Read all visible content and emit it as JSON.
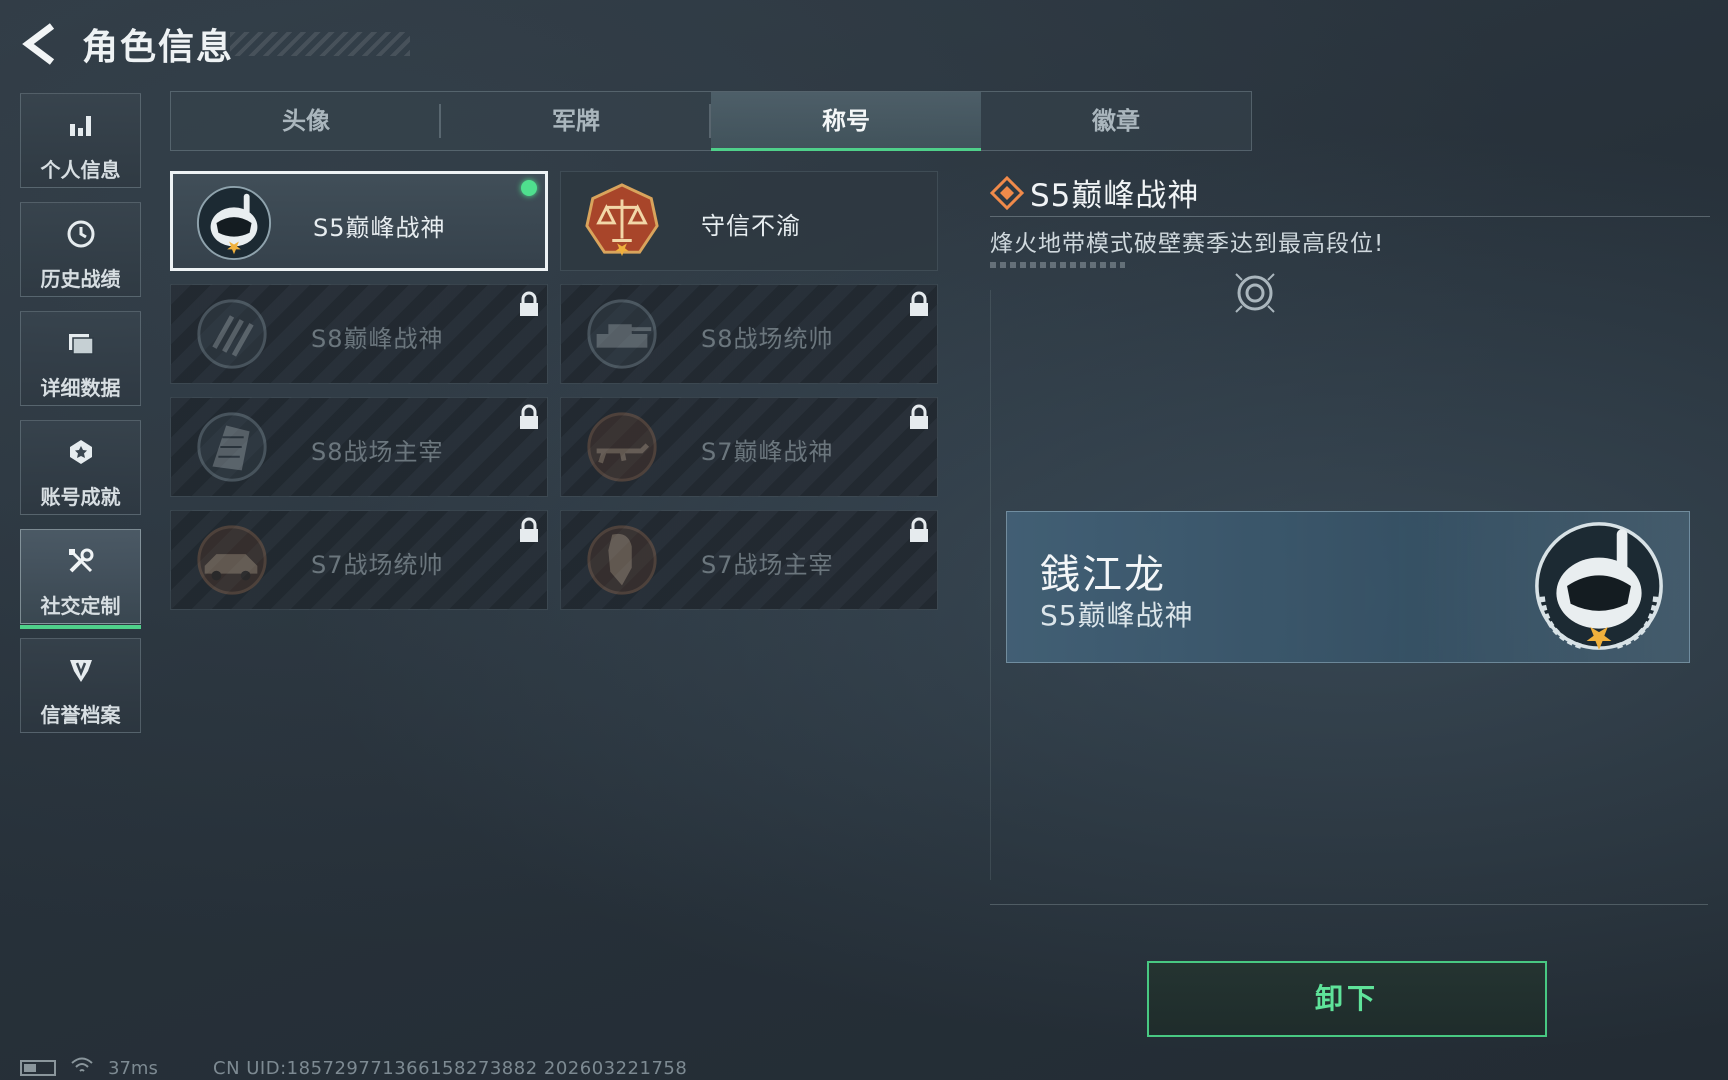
{
  "header": {
    "title": "角色信息"
  },
  "sidebar": {
    "items": [
      {
        "label": "个人信息",
        "icon": "bar-chart-icon"
      },
      {
        "label": "历史战绩",
        "icon": "history-icon"
      },
      {
        "label": "详细数据",
        "icon": "folder-icon"
      },
      {
        "label": "账号成就",
        "icon": "medal-icon"
      },
      {
        "label": "社交定制",
        "icon": "tools-icon",
        "active": true
      },
      {
        "label": "信誉档案",
        "icon": "shield-icon"
      }
    ]
  },
  "tabs": [
    {
      "label": "头像"
    },
    {
      "label": "军牌"
    },
    {
      "label": "称号",
      "active": true
    },
    {
      "label": "徽章"
    }
  ],
  "titles": [
    {
      "label": "S5巅峰战神",
      "locked": false,
      "selected": true,
      "equipped": true,
      "badge": "snorkel-mask-badge"
    },
    {
      "label": "守信不渝",
      "locked": false,
      "selected": false,
      "badge": "scales-badge"
    },
    {
      "label": "S8巅峰战神",
      "locked": true,
      "badge": "stripes-badge"
    },
    {
      "label": "S8战场统帅",
      "locked": true,
      "badge": "tank-badge"
    },
    {
      "label": "S8战场主宰",
      "locked": true,
      "badge": "building-badge"
    },
    {
      "label": "S7巅峰战神",
      "locked": true,
      "badge": "rifle-badge"
    },
    {
      "label": "S7战场统帅",
      "locked": true,
      "badge": "vehicle-badge"
    },
    {
      "label": "S7战场主宰",
      "locked": true,
      "badge": "soldier-badge"
    }
  ],
  "detail": {
    "title": "S5巅峰战神",
    "description": "烽火地带模式破壁赛季达到最高段位!"
  },
  "preview": {
    "player_name": "銭江龙",
    "title": "S5巅峰战神"
  },
  "actions": {
    "unequip_label": "卸下"
  },
  "status": {
    "ping": "37ms",
    "uid": "CN UID:185729771366158273882 202603221758"
  },
  "colors": {
    "accent_green": "#4fd08a",
    "lock": "#e6ebee"
  }
}
